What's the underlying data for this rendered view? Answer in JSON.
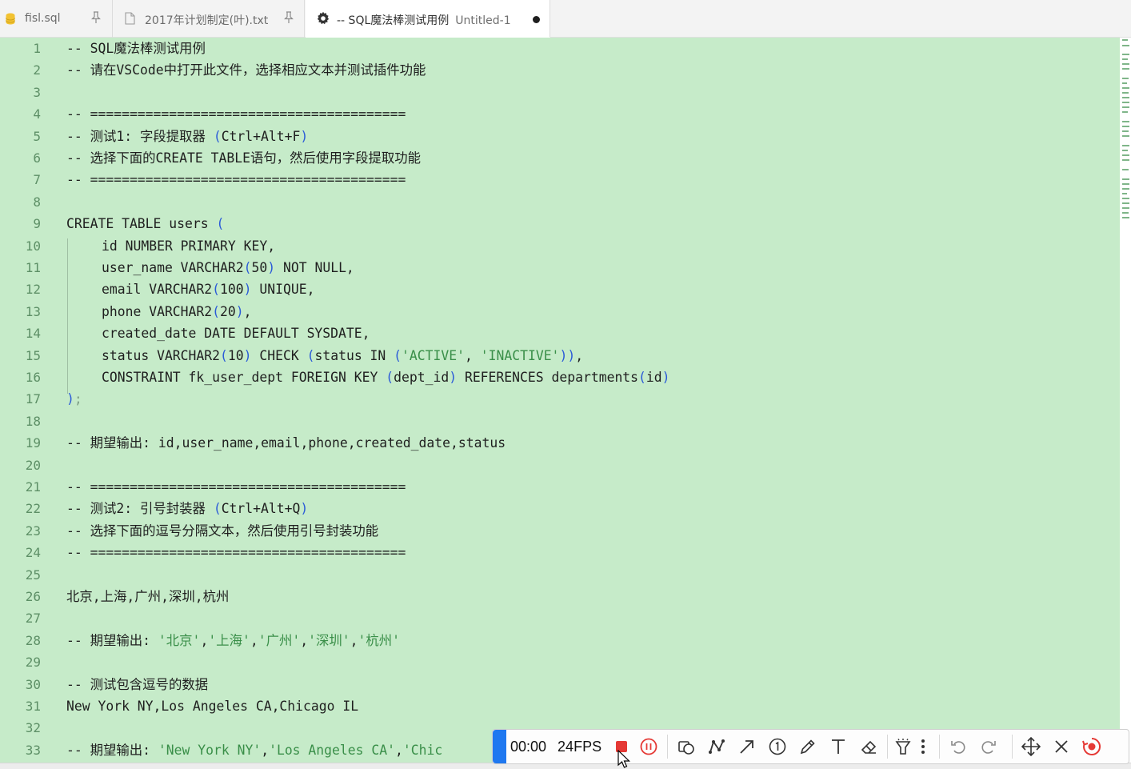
{
  "tabs": [
    {
      "label": "fisl.sql",
      "icon": "database-icon",
      "pinned": true
    },
    {
      "label": "2017年计划制定(叶).txt",
      "icon": "file-icon",
      "pinned": true
    },
    {
      "label": "-- SQL魔法棒测试用例",
      "extra": "Untitled-1",
      "icon": "gear-icon",
      "active": true,
      "dirty": true
    }
  ],
  "editor": {
    "lines": [
      {
        "n": "1"
      },
      {
        "n": "2"
      },
      {
        "n": "3"
      },
      {
        "n": "4"
      },
      {
        "n": "5"
      },
      {
        "n": "6"
      },
      {
        "n": "7"
      },
      {
        "n": "8"
      },
      {
        "n": "9"
      },
      {
        "n": "10"
      },
      {
        "n": "11"
      },
      {
        "n": "12"
      },
      {
        "n": "13"
      },
      {
        "n": "14"
      },
      {
        "n": "15"
      },
      {
        "n": "16"
      },
      {
        "n": "17"
      },
      {
        "n": "18"
      },
      {
        "n": "19"
      },
      {
        "n": "20"
      },
      {
        "n": "21"
      },
      {
        "n": "22"
      },
      {
        "n": "23"
      },
      {
        "n": "24"
      },
      {
        "n": "25"
      },
      {
        "n": "26"
      },
      {
        "n": "27"
      },
      {
        "n": "28"
      },
      {
        "n": "29"
      },
      {
        "n": "30"
      },
      {
        "n": "31"
      },
      {
        "n": "32"
      },
      {
        "n": "33"
      }
    ],
    "tokens": {
      "l1": "-- SQL魔法棒测试用例",
      "l2": "-- 请在VSCode中打开此文件，选择相应文本并测试插件功能",
      "l4": "-- ========================================",
      "l5a": "-- 测试1: 字段提取器 ",
      "l5b": "(",
      "l5c": "Ctrl+Alt+F",
      "l5d": ")",
      "l6": "-- 选择下面的CREATE TABLE语句，然后使用字段提取功能",
      "l7": "-- ========================================",
      "l9a": "CREATE TABLE users ",
      "l9b": "(",
      "l10": "id NUMBER PRIMARY KEY,",
      "l11a": "user_name VARCHAR2",
      "l11b": "(",
      "l11c": "50",
      "l11d": ")",
      "l11e": " NOT NULL,",
      "l12a": "email VARCHAR2",
      "l12b": "(",
      "l12c": "100",
      "l12d": ")",
      "l12e": " UNIQUE,",
      "l13a": "phone VARCHAR2",
      "l13b": "(",
      "l13c": "20",
      "l13d": ")",
      "l13e": ",",
      "l14": "created_date DATE DEFAULT SYSDATE,",
      "l15a": "status VARCHAR2",
      "l15b": "(",
      "l15c": "10",
      "l15d": ")",
      "l15e": " CHECK ",
      "l15f": "(",
      "l15g": "status IN ",
      "l15h": "(",
      "l15i": "'ACTIVE'",
      "l15j": ", ",
      "l15k": "'INACTIVE'",
      "l15l": ")",
      "l15m": ")",
      "l15n": ",",
      "l16a": "CONSTRAINT fk_user_dept FOREIGN KEY ",
      "l16b": "(",
      "l16c": "dept_id",
      "l16d": ")",
      "l16e": " REFERENCES departments",
      "l16f": "(",
      "l16g": "id",
      "l16h": ")",
      "l17a": ")",
      "l17b": ";",
      "l19": "-- 期望输出: id,user_name,email,phone,created_date,status",
      "l21": "-- ========================================",
      "l22a": "-- 测试2: 引号封装器 ",
      "l22b": "(",
      "l22c": "Ctrl+Alt+Q",
      "l22d": ")",
      "l23": "-- 选择下面的逗号分隔文本，然后使用引号封装功能",
      "l24": "-- ========================================",
      "l26": "北京,上海,广州,深圳,杭州",
      "l28a": "-- 期望输出: ",
      "l28b": "'北京'",
      "l28c": ",",
      "l28d": "'上海'",
      "l28e": ",",
      "l28f": "'广州'",
      "l28g": ",",
      "l28h": "'深圳'",
      "l28i": ",",
      "l28j": "'杭州'",
      "l30": "-- 测试包含逗号的数据",
      "l31": "New York NY,Los Angeles CA,Chicago IL",
      "l33a": "-- 期望输出: ",
      "l33b": "'New York NY'",
      "l33c": ",",
      "l33d": "'Los Angeles CA'",
      "l33e": ",",
      "l33f": "'Chic"
    }
  },
  "recorder": {
    "time": "00:00",
    "fps": "24FPS",
    "tools": [
      "stop-icon",
      "pause-icon",
      "shape-icon",
      "polyline-icon",
      "arrow-icon",
      "number-marker-icon",
      "pen-icon",
      "text-icon",
      "eraser-icon",
      "spotlight-icon",
      "more-icon",
      "undo-icon",
      "redo-icon",
      "move-icon",
      "close-icon",
      "record-icon"
    ]
  },
  "colors": {
    "editor_bg": "#c6ebc9",
    "bracket": "#2b5bd8",
    "string": "#3a8f49",
    "line_number": "#5d8f66",
    "recorder_handle": "#1f78f0",
    "stop_red": "#e53935"
  }
}
